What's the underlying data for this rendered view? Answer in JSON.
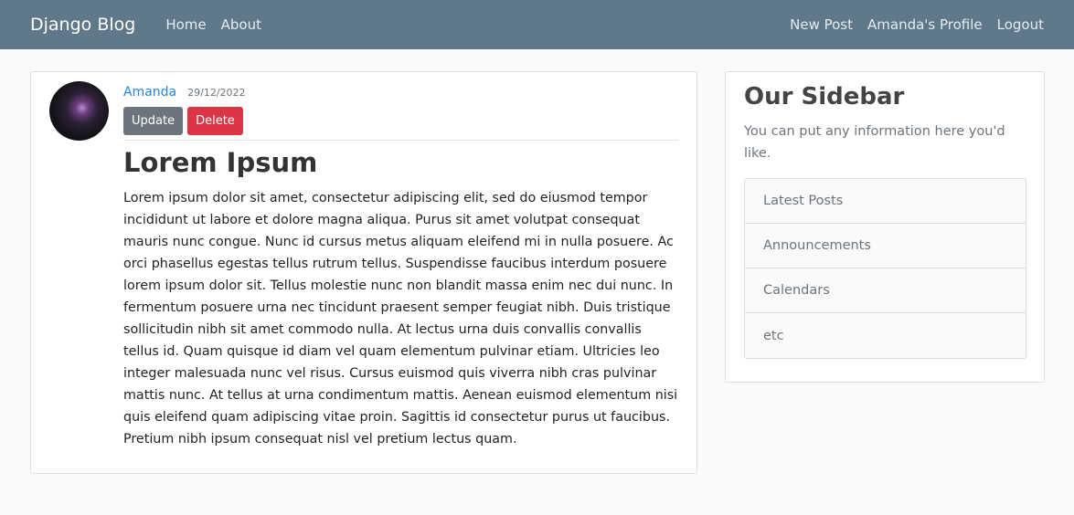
{
  "navbar": {
    "brand": "Django Blog",
    "left_links": [
      "Home",
      "About"
    ],
    "right_links": [
      "New Post",
      "Amanda's Profile",
      "Logout"
    ]
  },
  "post": {
    "author": "Amanda",
    "date": "29/12/2022",
    "update_label": "Update",
    "delete_label": "Delete",
    "title": "Lorem Ipsum",
    "body": "Lorem ipsum dolor sit amet, consectetur adipiscing elit, sed do eiusmod tempor incididunt ut labore et dolore magna aliqua. Purus sit amet volutpat consequat mauris nunc congue. Nunc id cursus metus aliquam eleifend mi in nulla posuere. Ac orci phasellus egestas tellus rutrum tellus. Suspendisse faucibus interdum posuere lorem ipsum dolor sit. Tellus molestie nunc non blandit massa enim nec dui nunc. In fermentum posuere urna nec tincidunt praesent semper feugiat nibh. Duis tristique sollicitudin nibh sit amet commodo nulla. At lectus urna duis convallis convallis tellus id. Quam quisque id diam vel quam elementum pulvinar etiam. Ultricies leo integer malesuada nunc vel risus. Cursus euismod quis viverra nibh cras pulvinar mattis nunc. At tellus at urna condimentum mattis. Aenean euismod elementum nisi quis eleifend quam adipiscing vitae proin. Sagittis id consectetur purus ut faucibus. Pretium nibh ipsum consequat nisl vel pretium lectus quam."
  },
  "sidebar": {
    "title": "Our Sidebar",
    "text": "You can put any information here you'd like.",
    "items": [
      "Latest Posts",
      "Announcements",
      "Calendars",
      "etc"
    ]
  },
  "colors": {
    "navbar": "#5f788a",
    "author_link": "#2a85d8",
    "update_button": "#6c757d",
    "delete_button": "#dc3545",
    "background": "#fafafa"
  }
}
